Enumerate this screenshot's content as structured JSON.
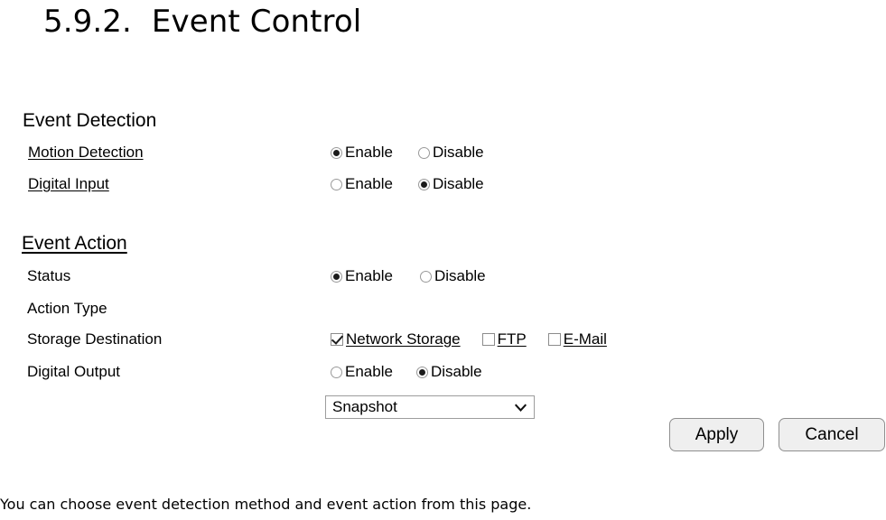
{
  "page": {
    "section_number": "5.9.2.",
    "title": "Event Control",
    "caption": "You can choose event detection method and event action from this page."
  },
  "event_detection": {
    "heading": "Event Detection",
    "rows": [
      {
        "label": "Motion Detection",
        "enable_label": "Enable",
        "disable_label": "Disable",
        "selected": "Enable"
      },
      {
        "label": "Digital Input",
        "enable_label": "Enable",
        "disable_label": "Disable",
        "selected": "Disable"
      }
    ]
  },
  "event_action": {
    "heading": "Event Action",
    "status": {
      "label": "Status",
      "enable_label": "Enable",
      "disable_label": "Disable",
      "selected": "Enable"
    },
    "action_type": {
      "label": "Action Type",
      "value": "Snapshot",
      "chevron_icon": "chevron-down-icon"
    },
    "storage_destination": {
      "label": "Storage Destination",
      "options": [
        {
          "label": "Network Storage",
          "checked": true
        },
        {
          "label": "FTP",
          "checked": false
        },
        {
          "label": "E-Mail",
          "checked": false
        }
      ]
    },
    "digital_output": {
      "label": "Digital Output",
      "enable_label": "Enable",
      "disable_label": "Disable",
      "selected": "Disable"
    }
  },
  "actions": {
    "apply_label": "Apply",
    "cancel_label": "Cancel"
  },
  "colors": {
    "text": "#000000",
    "border": "#9a9a9a",
    "button_face": "#efefef",
    "background": "#ffffff"
  }
}
